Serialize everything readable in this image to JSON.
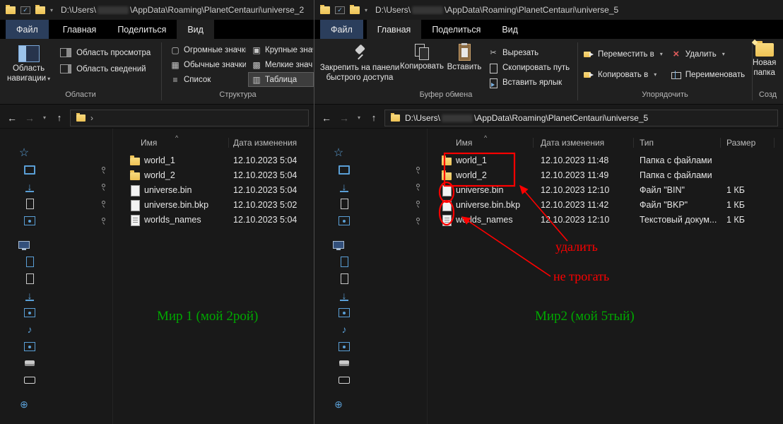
{
  "icons": {
    "back": "←",
    "forward": "→",
    "up": "↑",
    "chevron_down": "▾",
    "breadcrumb": "›",
    "sort_asc": "^",
    "check": "✓",
    "cut": "✂",
    "delete": "×",
    "star": "☆",
    "download": "↓",
    "music": "♪",
    "network": "⊕"
  },
  "tabs": {
    "file": "Файл",
    "home": "Главная",
    "share": "Поделиться",
    "view": "Вид"
  },
  "sidebar": {
    "items": [
      {
        "name": "quick-access",
        "glyph": "star",
        "level": 1
      },
      {
        "name": "desktop",
        "glyph": "desktop",
        "level": 2,
        "pinned": true
      },
      {
        "name": "downloads",
        "glyph": "download",
        "level": 2,
        "pinned": true
      },
      {
        "name": "documents",
        "glyph": "doc",
        "level": 2,
        "pinned": true
      },
      {
        "name": "pictures",
        "glyph": "pic",
        "level": 2,
        "pinned": true
      },
      {
        "name": "this-pc",
        "glyph": "monitor",
        "level": 1,
        "gap": true
      },
      {
        "name": "videos",
        "glyph": "doc-blue",
        "level": 2
      },
      {
        "name": "documents-folder",
        "glyph": "doc",
        "level": 2
      },
      {
        "name": "downloads-folder",
        "glyph": "download",
        "level": 2
      },
      {
        "name": "pictures-folder",
        "glyph": "pic",
        "level": 2
      },
      {
        "name": "music",
        "glyph": "music",
        "level": 2
      },
      {
        "name": "objects-3d",
        "glyph": "pic",
        "level": 2
      },
      {
        "name": "local-disk-c",
        "glyph": "disk",
        "level": 2
      },
      {
        "name": "local-disk-d",
        "glyph": "disk-dark",
        "level": 2
      },
      {
        "name": "network",
        "glyph": "network",
        "level": 1,
        "gap": true
      }
    ]
  },
  "left": {
    "title": {
      "prefix": "D:\\Users\\",
      "suffix": "\\AppData\\Roaming\\PlanetCentauri\\universe_2"
    },
    "ribbon": {
      "nav_pane_line1": "Область",
      "nav_pane_line2": "навигации",
      "preview_pane": "Область просмотра",
      "details_pane": "Область сведений",
      "views": [
        {
          "label": "Огромные значки",
          "glyph": "▢"
        },
        {
          "label": "Крупные знач",
          "glyph": "▣"
        },
        {
          "label": "Обычные значки",
          "glyph": "▦"
        },
        {
          "label": "Мелкие знач",
          "glyph": "▩"
        },
        {
          "label": "Список",
          "glyph": "≡"
        },
        {
          "label": "Таблица",
          "glyph": "▥",
          "selected": true
        }
      ],
      "group_panes": "Области",
      "group_layout": "Структура"
    },
    "columns": [
      {
        "label": "Имя"
      },
      {
        "label": "Дата изменения"
      }
    ],
    "rows": [
      {
        "icon": "folder",
        "name": "world_1",
        "date": "12.10.2023 5:04"
      },
      {
        "icon": "folder",
        "name": "world_2",
        "date": "12.10.2023 5:04"
      },
      {
        "icon": "file",
        "name": "universe.bin",
        "date": "12.10.2023 5:04"
      },
      {
        "icon": "file",
        "name": "universe.bin.bkp",
        "date": "12.10.2023 5:02"
      },
      {
        "icon": "text",
        "name": "worlds_names",
        "date": "12.10.2023 5:04"
      }
    ],
    "annotation_text": "Мир 1 (мой 2рой)"
  },
  "right": {
    "title": {
      "prefix": "D:\\Users\\",
      "suffix": "\\AppData\\Roaming\\PlanetCentauri\\universe_5"
    },
    "address": {
      "prefix": "D:\\Users\\",
      "suffix": "\\AppData\\Roaming\\PlanetCentauri\\universe_5"
    },
    "ribbon": {
      "pin_line1": "Закрепить на панели",
      "pin_line2": "быстрого доступа",
      "copy": "Копировать",
      "paste": "Вставить",
      "cut": "Вырезать",
      "copy_path": "Скопировать путь",
      "paste_shortcut": "Вставить ярлык",
      "move_to": "Переместить в",
      "copy_to": "Копировать в",
      "delete": "Удалить",
      "rename": "Переименовать",
      "new_folder_line1": "Новая",
      "new_folder_line2": "папка",
      "group_clipboard": "Буфер обмена",
      "group_organize": "Упорядочить",
      "group_new": "Созд"
    },
    "columns": [
      {
        "label": "Имя"
      },
      {
        "label": "Дата изменения"
      },
      {
        "label": "Тип"
      },
      {
        "label": "Размер"
      }
    ],
    "rows": [
      {
        "icon": "folder",
        "name": "world_1",
        "date": "12.10.2023 11:48",
        "type": "Папка с файлами",
        "size": ""
      },
      {
        "icon": "folder",
        "name": "world_2",
        "date": "12.10.2023 11:49",
        "type": "Папка с файлами",
        "size": ""
      },
      {
        "icon": "file",
        "name": "universe.bin",
        "date": "12.10.2023 12:10",
        "type": "Файл \"BIN\"",
        "size": "1 КБ"
      },
      {
        "icon": "file",
        "name": "universe.bin.bkp",
        "date": "12.10.2023 11:42",
        "type": "Файл \"BKP\"",
        "size": "1 КБ"
      },
      {
        "icon": "text",
        "name": "worlds_names",
        "date": "12.10.2023 12:10",
        "type": "Текстовый докум...",
        "size": "1 КБ"
      }
    ],
    "annotations": {
      "delete_label": "удалить",
      "keep_label": "не трогать",
      "world_label": "Мир2 (мой 5тый)"
    }
  },
  "annotation_colors": {
    "red": "#ff0000",
    "green": "#00a800"
  }
}
